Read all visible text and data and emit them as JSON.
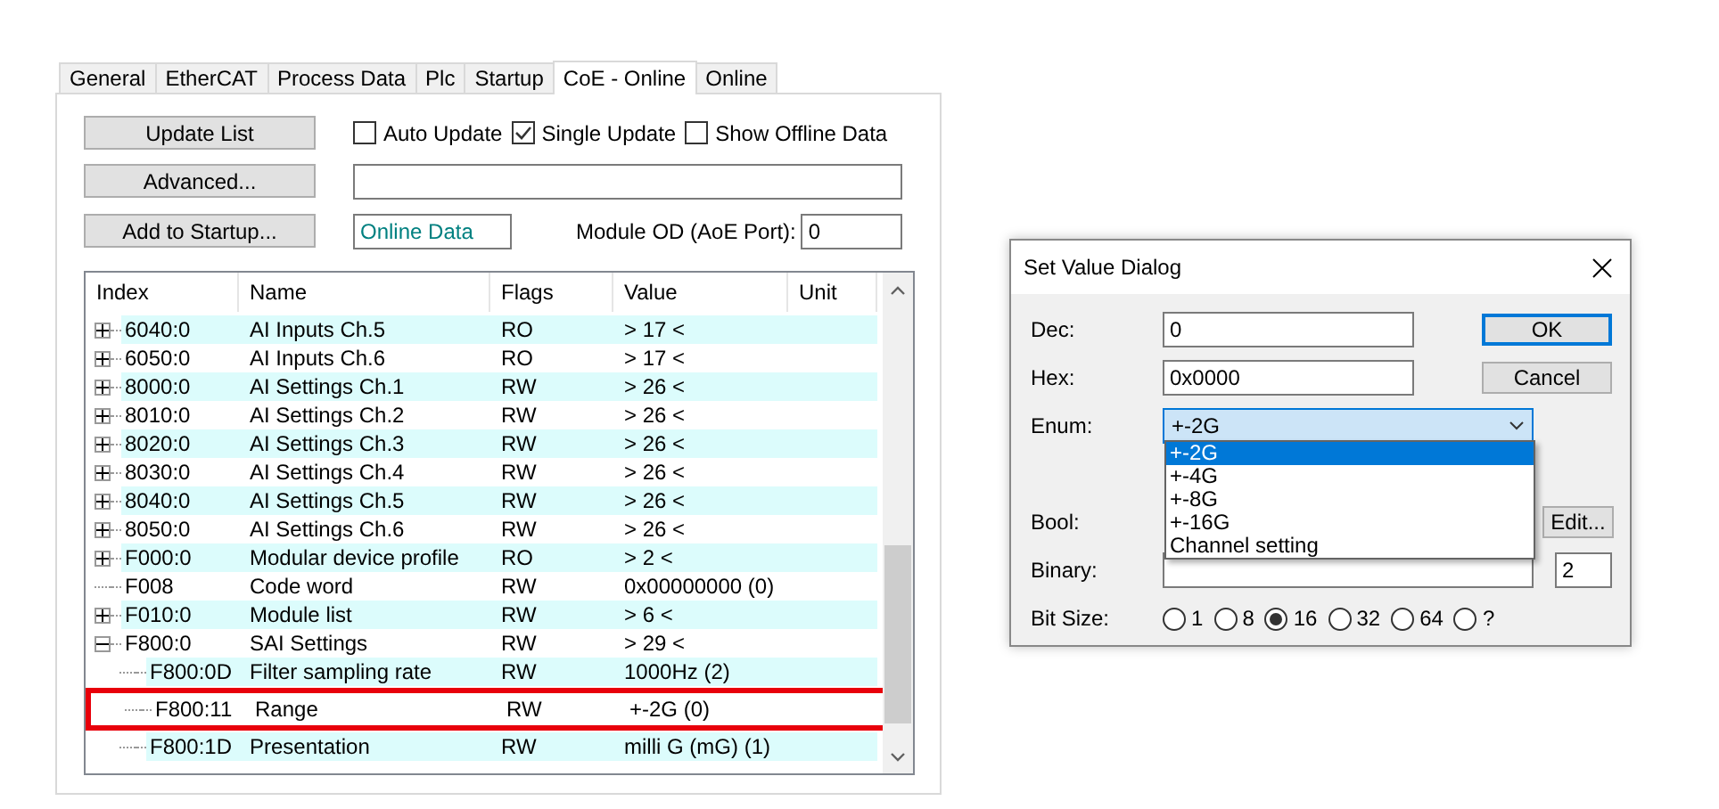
{
  "tabs": [
    {
      "label": "General",
      "selected": false
    },
    {
      "label": "EtherCAT",
      "selected": false
    },
    {
      "label": "Process Data",
      "selected": false
    },
    {
      "label": "Plc",
      "selected": false
    },
    {
      "label": "Startup",
      "selected": false
    },
    {
      "label": "CoE - Online",
      "selected": true
    },
    {
      "label": "Online",
      "selected": false
    }
  ],
  "buttons": [
    "Update List",
    "Advanced...",
    "Add to Startup..."
  ],
  "options": [
    {
      "label": "Auto Update",
      "checked": false
    },
    {
      "label": "Single Update",
      "checked": true
    },
    {
      "label": "Show Offline Data",
      "checked": false
    }
  ],
  "status_field": {
    "value": "Online Data"
  },
  "module_od": {
    "label": "Module OD (AoE Port):",
    "value": "0"
  },
  "table": {
    "columns": [
      "Index",
      "Name",
      "Flags",
      "Value",
      "Unit"
    ],
    "rows": [
      {
        "kind": "group",
        "expanded": false,
        "index": "6040:0",
        "name": "AI Inputs Ch.5",
        "flags": "RO",
        "value": "> 17 <"
      },
      {
        "kind": "group",
        "expanded": false,
        "index": "6050:0",
        "name": "AI Inputs Ch.6",
        "flags": "RO",
        "value": "> 17 <"
      },
      {
        "kind": "group",
        "expanded": false,
        "index": "8000:0",
        "name": "AI Settings Ch.1",
        "flags": "RW",
        "value": "> 26 <"
      },
      {
        "kind": "group",
        "expanded": false,
        "index": "8010:0",
        "name": "AI Settings Ch.2",
        "flags": "RW",
        "value": "> 26 <"
      },
      {
        "kind": "group",
        "expanded": false,
        "index": "8020:0",
        "name": "AI Settings Ch.3",
        "flags": "RW",
        "value": "> 26 <"
      },
      {
        "kind": "group",
        "expanded": false,
        "index": "8030:0",
        "name": "AI Settings Ch.4",
        "flags": "RW",
        "value": "> 26 <"
      },
      {
        "kind": "group",
        "expanded": false,
        "index": "8040:0",
        "name": "AI Settings Ch.5",
        "flags": "RW",
        "value": "> 26 <"
      },
      {
        "kind": "group",
        "expanded": false,
        "index": "8050:0",
        "name": "AI Settings Ch.6",
        "flags": "RW",
        "value": "> 26 <"
      },
      {
        "kind": "group",
        "expanded": false,
        "index": "F000:0",
        "name": "Modular device profile",
        "flags": "RO",
        "value": "> 2 <"
      },
      {
        "kind": "entry",
        "index": "F008",
        "name": "Code word",
        "flags": "RW",
        "value": "0x00000000 (0)"
      },
      {
        "kind": "group",
        "expanded": false,
        "index": "F010:0",
        "name": "Module list",
        "flags": "RW",
        "value": "> 6 <"
      },
      {
        "kind": "group",
        "expanded": true,
        "index": "F800:0",
        "name": "SAI Settings",
        "flags": "RW",
        "value": "> 29 <",
        "children": [
          {
            "kind": "entry",
            "index": "F800:0D",
            "name": "Filter sampling rate",
            "flags": "RW",
            "value": "1000Hz (2)",
            "highlighted": false
          },
          {
            "kind": "entry",
            "index": "F800:11",
            "name": "Range",
            "flags": "RW",
            "value": "+-2G (0)",
            "highlighted": true
          },
          {
            "kind": "entry",
            "index": "F800:1D",
            "name": "Presentation",
            "flags": "RW",
            "value": "milli G (mG) (1)",
            "highlighted": false
          }
        ]
      }
    ]
  },
  "dialog": {
    "title": "Set Value Dialog",
    "dec": {
      "label": "Dec:",
      "value": "0"
    },
    "hex": {
      "label": "Hex:",
      "value": "0x0000"
    },
    "enum": {
      "label": "Enum:",
      "value": "+-2G",
      "options": [
        {
          "label": "+-2G",
          "selected": true
        },
        {
          "label": "+-4G",
          "selected": false
        },
        {
          "label": "+-8G",
          "selected": false
        },
        {
          "label": "+-16G",
          "selected": false
        },
        {
          "label": "Channel setting",
          "selected": false
        }
      ]
    },
    "bool": {
      "label": "Bool:"
    },
    "binary": {
      "label": "Binary:",
      "length": "2"
    },
    "buttons": [
      "OK",
      "Cancel",
      "Edit..."
    ],
    "bit_size": {
      "label": "Bit Size:",
      "options": [
        {
          "label": "1",
          "selected": false
        },
        {
          "label": "8",
          "selected": false
        },
        {
          "label": "16",
          "selected": true
        },
        {
          "label": "32",
          "selected": false
        },
        {
          "label": "64",
          "selected": false
        },
        {
          "label": "?",
          "selected": false
        }
      ]
    }
  }
}
